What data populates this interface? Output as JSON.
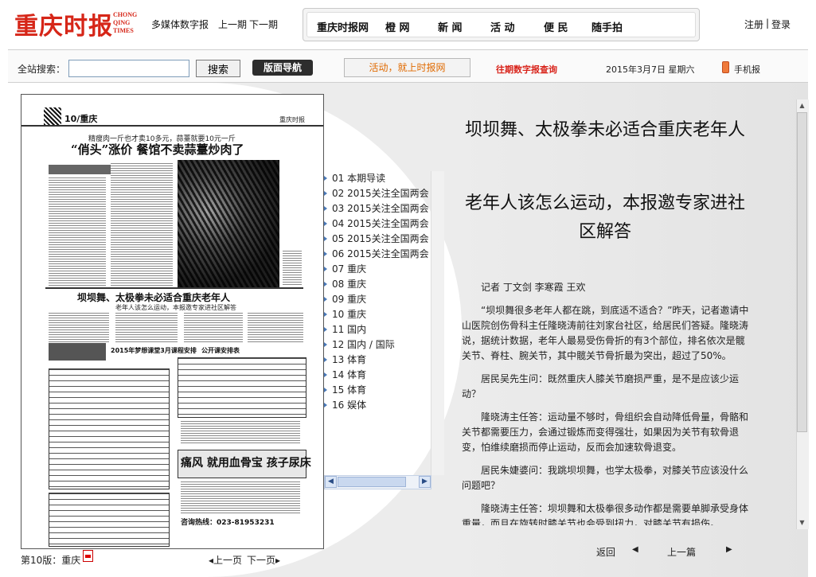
{
  "header": {
    "logo_cn": "重庆时报",
    "logo_en": "CHONG QING TIMES",
    "links": [
      "多媒体数字报",
      "上一期",
      "下一期"
    ],
    "user": {
      "register": "注册",
      "separator": "|",
      "login": "登录"
    }
  },
  "nav": {
    "items": [
      "重庆时报网",
      "橙 网",
      "新 闻",
      "活 动",
      "便 民",
      "随手拍"
    ]
  },
  "search": {
    "label": "全站搜索：",
    "value": "",
    "button": "搜索",
    "page_nav": "版面导航",
    "promo": "活动，就上时报网",
    "archive": "往期数字报查询",
    "date": "2015年3月7日 星期六",
    "mobile": "手机报"
  },
  "newspaper": {
    "page_no": "10/重庆",
    "brand": "重庆时报",
    "kicker": "精瘦肉一斤也才卖10多元，蒜薹就要10元一斤",
    "headline": "“俏头”涨价  餐馆不卖蒜薹炒肉了",
    "headline2": "坝坝舞、太极拳未必适合重庆老年人",
    "sub2": "老年人该怎么运动，本报邀专家进社区解答",
    "ad1": "2015年梦想课堂3月课程安排",
    "ad2": "公开课安排表",
    "ad_big": "痛风 就用血骨宝  孩子尿床 ",
    "phone": "咨询热线：023-81953231"
  },
  "editions": [
    "01 本期导读",
    "02 2015关注全国两会",
    "03 2015关注全国两会",
    "04 2015关注全国两会",
    "05 2015关注全国两会",
    "06 2015关注全国两会",
    "07 重庆",
    "08 重庆",
    "09 重庆",
    "10 重庆",
    "11 国内",
    "12 国内 / 国际",
    "13 体育",
    "14 体育",
    "15 体育",
    "16 娱体"
  ],
  "article": {
    "title": "坝坝舞、太极拳未必适合重庆老年人",
    "subtitle": "老年人该怎么运动，本报邀专家进社区解答",
    "paragraphs": [
      "记者 丁文剑 李寒霞 王欢",
      "“坝坝舞很多老年人都在跳，到底适不适合？”昨天，记者邀请中山医院创伤骨科主任隆晓涛前往刘家台社区，给居民们答疑。隆晓涛说，据统计数据，老年人最易受伤骨折的有3个部位，排名依次是髋关节、脊柱、腕关节，其中髋关节骨折最为突出，超过了50%。",
      "居民吴先生问：既然重庆人膝关节磨损严重，是不是应该少运动？",
      "隆晓涛主任答：运动量不够时，骨组织会自动降低骨量，骨骼和关节都需要压力，会通过锻炼而变得强壮，如果因为关节有软骨退变，怕维续磨损而停止运动，反而会加速软骨退变。",
      "居民朱婕婆问：我跳坝坝舞，也学太极拳，对膝关节应该没什么问题吧？",
      "隆晓涛主任答：坝坝舞和太极拳很多动作都是需要单脚承受身体重量，而且在旋转时膝关节也会受到扭力，对膝关节有损伤。"
    ]
  },
  "footer": {
    "page_label": "第10版：重庆",
    "prev_page": "◂上一页",
    "next_page": "下一页▸",
    "back": "返回",
    "prev_arrow": "◀",
    "prev_article": "上一篇",
    "next_arrow": "▶"
  },
  "colors": {
    "brand_red": "#d62618",
    "promo_orange": "#e06a00",
    "archive_red": "#d8231a"
  },
  "icons": {
    "mobile": "mobile-phone-icon",
    "pdf": "pdf-icon"
  }
}
